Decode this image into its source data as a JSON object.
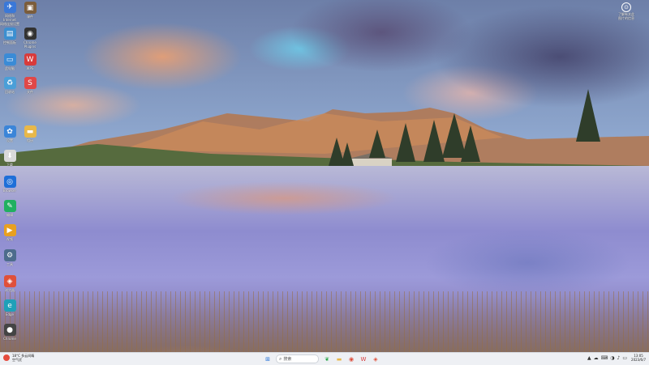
{
  "desktop": {
    "icons": [
      {
        "label": "网络和Internet\n网络连接设置",
        "icon": "network-icon",
        "color": "#3a78d8",
        "glyph": "✈"
      },
      {
        "label": "课件",
        "icon": "folder-image-icon",
        "color": "#7b5d3c",
        "glyph": "▣"
      },
      {
        "label": "控制面板",
        "icon": "control-panel-icon",
        "color": "#3c8fd0",
        "glyph": "▤"
      },
      {
        "label": "Chrome\nPlugins",
        "icon": "plugin-icon",
        "color": "#333333",
        "glyph": "◉"
      },
      {
        "label": "此电脑",
        "icon": "computer-icon",
        "color": "#3a8bd6",
        "glyph": "▭"
      },
      {
        "label": "WPS",
        "icon": "wps-icon",
        "color": "#d83b3b",
        "glyph": "W"
      },
      {
        "label": "回收站",
        "icon": "recycle-bin-icon",
        "color": "#4a9fd8",
        "glyph": "♻"
      },
      {
        "label": "文件",
        "icon": "file-app-icon",
        "color": "#e04848",
        "glyph": "S"
      },
      {
        "label": "设置",
        "icon": "settings-app-icon",
        "color": "#3b85d8",
        "glyph": "✿"
      },
      {
        "label": "相册",
        "icon": "folder-icon",
        "color": "#e8b84a",
        "glyph": "▬"
      },
      {
        "label": "下载",
        "icon": "download-app-icon",
        "color": "#d9d9d9",
        "glyph": "⬇"
      },
      {
        "label": "Browser",
        "icon": "browser-icon",
        "color": "#1f6fd8",
        "glyph": "◎"
      },
      {
        "label": "编辑",
        "icon": "leaf-app-icon",
        "color": "#20b060",
        "glyph": "✎"
      },
      {
        "label": "视频",
        "icon": "video-app-icon",
        "color": "#e8a020",
        "glyph": "▶"
      },
      {
        "label": "工具",
        "icon": "tool-app-icon",
        "color": "#4d6c8c",
        "glyph": "⚙"
      },
      {
        "label": "浏览器",
        "icon": "red-browser-icon",
        "color": "#e0503a",
        "glyph": "◈"
      },
      {
        "label": "Edge",
        "icon": "edge-icon",
        "color": "#1fa0b8",
        "glyph": "e"
      },
      {
        "label": "Chrome",
        "icon": "chrome-icon",
        "color": "#444444",
        "glyph": "●"
      }
    ],
    "learn_widget": {
      "label": "了解有关此\n图片的信息",
      "glyph": "⊙"
    }
  },
  "taskbar": {
    "weather": {
      "line1": "18°C 多云间晴",
      "line2": "空气优"
    },
    "search_placeholder": "搜索",
    "search_glyph": "⌕",
    "start_glyph": "⊞",
    "apps": [
      {
        "icon": "leaf-taskbar-icon",
        "glyph": "❦",
        "color": "#2aa84a"
      },
      {
        "icon": "file-explorer-icon",
        "glyph": "▬",
        "color": "#e8b84a"
      },
      {
        "icon": "chrome-taskbar-icon",
        "glyph": "◉",
        "color": "#dd4b39"
      },
      {
        "icon": "wps-taskbar-icon",
        "glyph": "W",
        "color": "#d83b3b"
      },
      {
        "icon": "red-app-taskbar-icon",
        "glyph": "◈",
        "color": "#e0503a"
      }
    ],
    "tray_glyphs": [
      "▲",
      "☁",
      "⌨",
      "◑",
      "♪",
      "▭"
    ],
    "clock": {
      "time": "13:05",
      "date": "2023/6/7"
    }
  }
}
